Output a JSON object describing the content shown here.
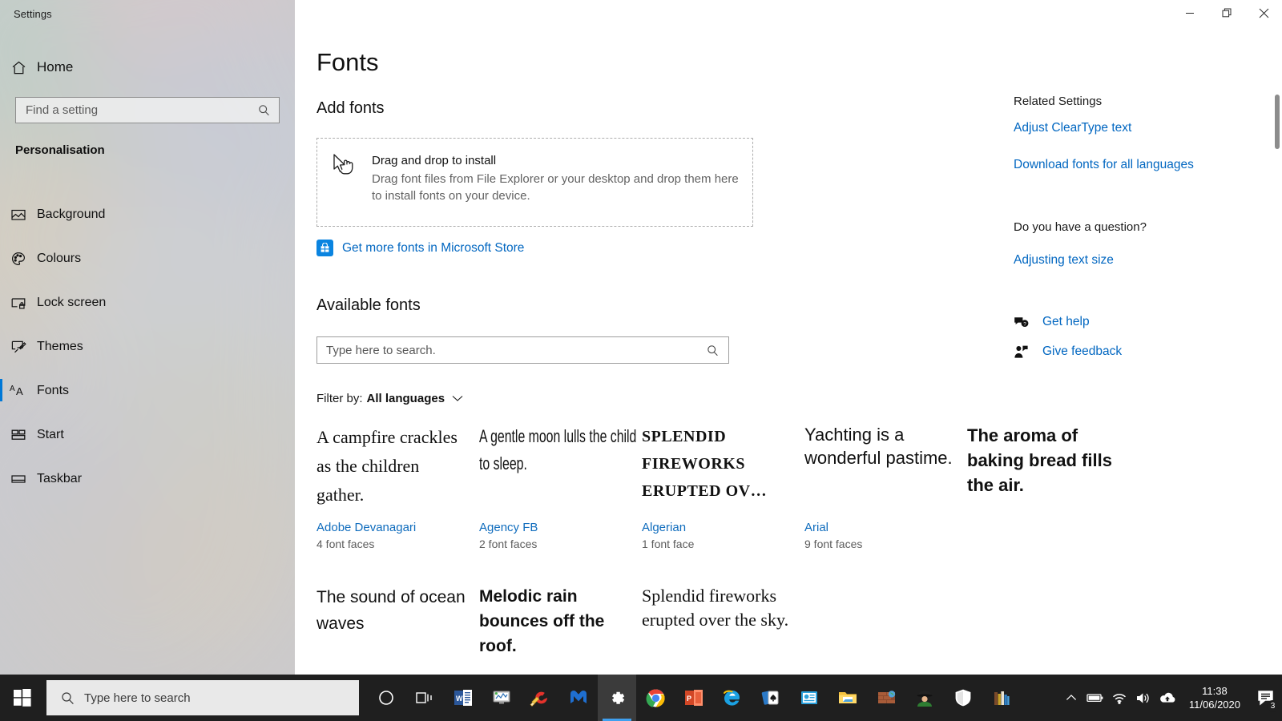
{
  "window": {
    "app_title": "Settings",
    "minimize_label": "Minimize",
    "restore_label": "Restore",
    "close_label": "Close"
  },
  "sidebar": {
    "home_label": "Home",
    "search": {
      "placeholder": "Find a setting",
      "icon": "search-icon"
    },
    "group_title": "Personalisation",
    "items": [
      {
        "label": "Background",
        "icon": "picture-icon",
        "selected": false
      },
      {
        "label": "Colours",
        "icon": "palette-icon",
        "selected": false
      },
      {
        "label": "Lock screen",
        "icon": "lockscreen-icon",
        "selected": false
      },
      {
        "label": "Themes",
        "icon": "brush-icon",
        "selected": false
      },
      {
        "label": "Fonts",
        "icon": "font-icon",
        "selected": true
      },
      {
        "label": "Start",
        "icon": "start-icon",
        "selected": false
      },
      {
        "label": "Taskbar",
        "icon": "taskbar-icon",
        "selected": false
      }
    ]
  },
  "main": {
    "page_title": "Fonts",
    "add_fonts_heading": "Add fonts",
    "dropzone": {
      "title": "Drag and drop to install",
      "subtitle": "Drag font files from File Explorer or your desktop and drop them here to install fonts on your device.",
      "icon": "drag-cursor-icon"
    },
    "store_link": {
      "label": "Get more fonts in Microsoft Store",
      "icon": "microsoft-store-icon"
    },
    "available_fonts_heading": "Available fonts",
    "font_search": {
      "placeholder": "Type here to search.",
      "value": "",
      "icon": "search-icon"
    },
    "filter": {
      "label": "Filter by:",
      "value": "All languages",
      "icon": "chevron-down-icon"
    },
    "fonts": [
      {
        "preview": "A campfire crackles as the children gather.",
        "name": "Adobe Devanagari",
        "faces": "4 font faces",
        "style": "pv-serif"
      },
      {
        "preview": "A gentle moon lulls the child to sleep.",
        "name": "Agency FB",
        "faces": "2 font faces",
        "style": "pv-cond"
      },
      {
        "preview": "SPLENDID FIREWORKS ERUPTED OV…",
        "name": "Algerian",
        "faces": "1 font face",
        "style": "pv-decor"
      },
      {
        "preview": "Yachting is a wonderful pastime.",
        "name": "Arial",
        "faces": "9 font faces",
        "style": "pv-sans"
      },
      {
        "preview": "The aroma of baking bread fills the air.",
        "name": "",
        "faces": "",
        "style": "pv-sansbold"
      },
      {
        "preview": "The sound of ocean waves",
        "name": "",
        "faces": "",
        "style": "pv-sans2"
      },
      {
        "preview": "Melodic rain bounces off the roof.",
        "name": "",
        "faces": "",
        "style": "pv-sansb2"
      },
      {
        "preview": "Splendid fireworks erupted over the sky.",
        "name": "",
        "faces": "",
        "style": "pv-serif2"
      }
    ]
  },
  "right_panel": {
    "related_heading": "Related Settings",
    "related_links": [
      "Adjust ClearType text",
      "Download fonts for all languages"
    ],
    "question_heading": "Do you have a question?",
    "question_links": [
      "Adjusting text size"
    ],
    "support": [
      {
        "label": "Get help",
        "icon": "help-chat-icon"
      },
      {
        "label": "Give feedback",
        "icon": "feedback-person-icon"
      }
    ]
  },
  "taskbar": {
    "start_label": "Start",
    "search": {
      "placeholder": "Type here to search",
      "icon": "search-icon"
    },
    "pinned": [
      {
        "name": "cortana-icon",
        "glyph": "○"
      },
      {
        "name": "task-view-icon",
        "glyph": "⧉"
      },
      {
        "name": "word-icon",
        "glyph": "W"
      },
      {
        "name": "monitor-chart-icon",
        "glyph": "🖥"
      },
      {
        "name": "ccleaner-icon",
        "glyph": "C"
      },
      {
        "name": "malwarebytes-icon",
        "glyph": "M"
      },
      {
        "name": "settings-icon",
        "glyph": "⚙",
        "active": true
      },
      {
        "name": "chrome-icon",
        "glyph": "◉"
      },
      {
        "name": "powerpoint-icon",
        "glyph": "P"
      },
      {
        "name": "internet-explorer-icon",
        "glyph": "e"
      },
      {
        "name": "solitaire-icon",
        "glyph": "♠"
      },
      {
        "name": "publisher-icon",
        "glyph": "▤"
      },
      {
        "name": "file-explorer-icon",
        "glyph": "📁"
      },
      {
        "name": "minecraft-icon",
        "glyph": "▦"
      },
      {
        "name": "spy-agent-icon",
        "glyph": "🕵"
      },
      {
        "name": "windows-defender-icon",
        "glyph": "🛡"
      },
      {
        "name": "books-library-icon",
        "glyph": "▮"
      }
    ],
    "tray": [
      {
        "name": "show-hidden-icons-icon",
        "glyph": "⌃"
      },
      {
        "name": "battery-icon",
        "glyph": "▭"
      },
      {
        "name": "wifi-icon",
        "glyph": "◗"
      },
      {
        "name": "volume-icon",
        "glyph": "🔊"
      },
      {
        "name": "onedrive-icon",
        "glyph": "☁"
      }
    ],
    "clock": {
      "time": "11:38",
      "date": "11/06/2020"
    },
    "action_center": {
      "icon": "action-center-icon",
      "badge": "3"
    }
  },
  "colors": {
    "accent": "#0078d7",
    "link": "#0267c1",
    "font_name_link": "#0f6cbd",
    "taskbar_bg": "#1f1f1f"
  }
}
